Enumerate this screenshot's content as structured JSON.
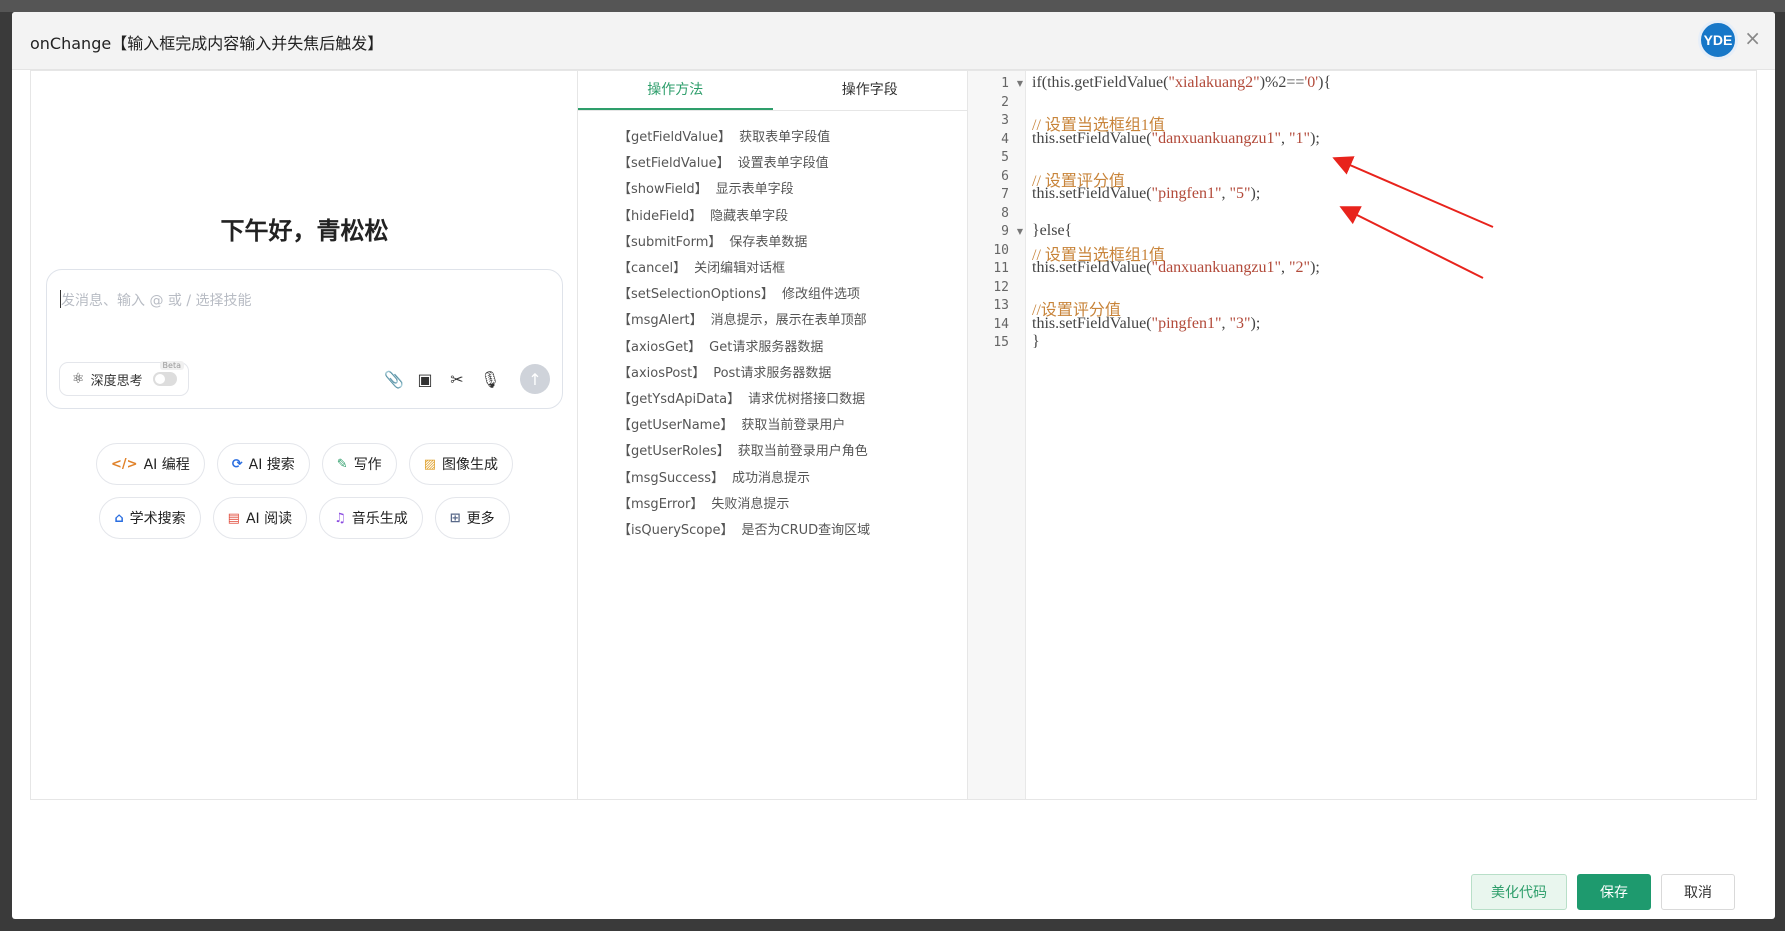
{
  "dialog": {
    "title": "onChange【输入框完成内容输入并失焦后触发】",
    "logo_text": "YDE",
    "close_glyph": "×"
  },
  "assistant": {
    "greeting": "下午好，青松松",
    "input_placeholder": "发消息、输入 @ 或 / 选择技能",
    "deep_think_label": "深度思考",
    "beta_label": "Beta",
    "chips_row1": [
      {
        "label": "AI 编程",
        "icon": "code-icon",
        "color": "#e0822a"
      },
      {
        "label": "AI 搜索",
        "icon": "search-refresh-icon",
        "color": "#2a6ee0"
      },
      {
        "label": "写作",
        "icon": "pen-icon",
        "color": "#2e9e6b"
      },
      {
        "label": "图像生成",
        "icon": "image-icon",
        "color": "#e0a02a"
      }
    ],
    "chips_row2": [
      {
        "label": "学术搜索",
        "icon": "graduation-icon",
        "color": "#2a6ee0"
      },
      {
        "label": "AI 阅读",
        "icon": "book-icon",
        "color": "#e04a3a"
      },
      {
        "label": "音乐生成",
        "icon": "music-icon",
        "color": "#8a4ae0"
      },
      {
        "label": "更多",
        "icon": "grid-icon",
        "color": "#5a6a8a"
      }
    ]
  },
  "methods_panel": {
    "tabs": [
      "操作方法",
      "操作字段"
    ],
    "active_tab": 0,
    "methods": [
      {
        "name": "【getFieldValue】",
        "desc": "获取表单字段值"
      },
      {
        "name": "【setFieldValue】",
        "desc": "设置表单字段值"
      },
      {
        "name": "【showField】",
        "desc": "显示表单字段"
      },
      {
        "name": "【hideField】",
        "desc": "隐藏表单字段"
      },
      {
        "name": "【submitForm】",
        "desc": "保存表单数据"
      },
      {
        "name": "【cancel】",
        "desc": "关闭编辑对话框"
      },
      {
        "name": "【setSelectionOptions】",
        "desc": "修改组件选项"
      },
      {
        "name": "【msgAlert】",
        "desc": "消息提示，展示在表单顶部"
      },
      {
        "name": "【axiosGet】",
        "desc": "Get请求服务器数据"
      },
      {
        "name": "【axiosPost】",
        "desc": "Post请求服务器数据"
      },
      {
        "name": "【getYsdApiData】",
        "desc": "请求优树搭接口数据"
      },
      {
        "name": "【getUserName】",
        "desc": "获取当前登录用户"
      },
      {
        "name": "【getUserRoles】",
        "desc": "获取当前登录用户角色"
      },
      {
        "name": "【msgSuccess】",
        "desc": "成功消息提示"
      },
      {
        "name": "【msgError】",
        "desc": "失败消息提示"
      },
      {
        "name": "【isQueryScope】",
        "desc": "是否为CRUD查询区域"
      }
    ]
  },
  "code_editor": {
    "lines": [
      "if(this.getFieldValue(\"xialakuang2\")%2=='0'){",
      "",
      "// 设置当选框组1值",
      "this.setFieldValue(\"danxuankuangzu1\", \"1\");",
      "",
      "// 设置评分值",
      "this.setFieldValue(\"pingfen1\", \"5\");",
      "",
      "}else{",
      "// 设置当选框组1值",
      "this.setFieldValue(\"danxuankuangzu1\", \"2\");",
      "",
      "//设置评分值",
      "this.setFieldValue(\"pingfen1\", \"3\");",
      "}"
    ],
    "fold_lines": [
      1,
      9
    ],
    "annotation_color": "#e8231c"
  },
  "footer": {
    "beautify_label": "美化代码",
    "save_label": "保存",
    "cancel_label": "取消"
  }
}
